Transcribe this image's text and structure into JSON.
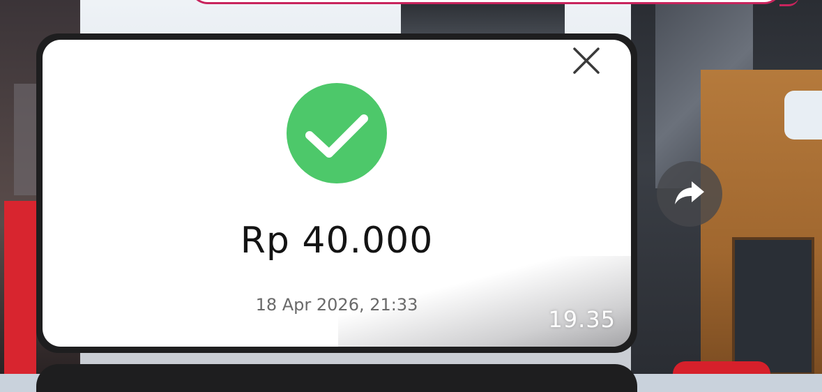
{
  "message": {
    "amount": "Rp 40.000",
    "datetime": "18 Apr 2026, 21:33",
    "timestamp": "19.35",
    "success_icon": "checkmark-circle-icon",
    "close_icon": "close-icon"
  },
  "actions": {
    "share_icon": "forward-arrow-icon"
  },
  "colors": {
    "success_green": "#4dc86a",
    "bubble_border": "#1e1e1f",
    "accent_pink": "#c8245d"
  }
}
